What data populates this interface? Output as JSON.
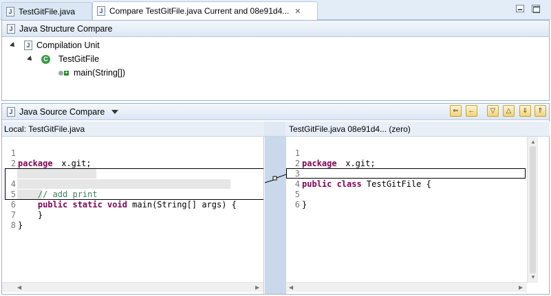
{
  "tabs": [
    {
      "label": "TestGitFile.java",
      "icon": "java-file-icon",
      "active": false
    },
    {
      "label": "Compare TestGitFile.java Current and 08e91d4...",
      "icon": "compare-icon",
      "active": true,
      "close": "✕"
    }
  ],
  "structure_compare": {
    "title": "Java Structure Compare",
    "tree": [
      {
        "label": "Compilation Unit",
        "icon": "java-file-icon",
        "level": 0
      },
      {
        "label": "TestGitFile",
        "icon": "class-icon",
        "level": 1
      },
      {
        "label": "main(String[])",
        "icon": "method-added-icon",
        "level": 2
      }
    ]
  },
  "source_compare": {
    "title": "Java Source Compare",
    "toolbar_icons": [
      "copy-all-left-icon",
      "copy-current-left-icon",
      "next-difference-icon",
      "previous-difference-icon",
      "next-change-icon",
      "previous-change-icon"
    ],
    "left": {
      "title": "Local: TestGitFile.java",
      "lines": [
        {
          "n": "1",
          "text": "package x.git;"
        },
        {
          "n": "2",
          "text": ""
        },
        {
          "n": "3",
          "text": "public class TestGitFile {"
        },
        {
          "n": "4",
          "text": "    // add print"
        },
        {
          "n": "5",
          "text": "    public static void main(String[] args) {"
        },
        {
          "n": "6",
          "text": "    }"
        },
        {
          "n": "7",
          "text": "}"
        },
        {
          "n": "8",
          "text": ""
        }
      ]
    },
    "right": {
      "title": "TestGitFile.java 08e91d4... (zero)",
      "lines": [
        {
          "n": "1",
          "text": "package x.git;"
        },
        {
          "n": "2",
          "text": ""
        },
        {
          "n": "3",
          "text": "public class TestGitFile {"
        },
        {
          "n": "4",
          "text": ""
        },
        {
          "n": "5",
          "text": "}"
        },
        {
          "n": "6",
          "text": ""
        }
      ]
    }
  }
}
